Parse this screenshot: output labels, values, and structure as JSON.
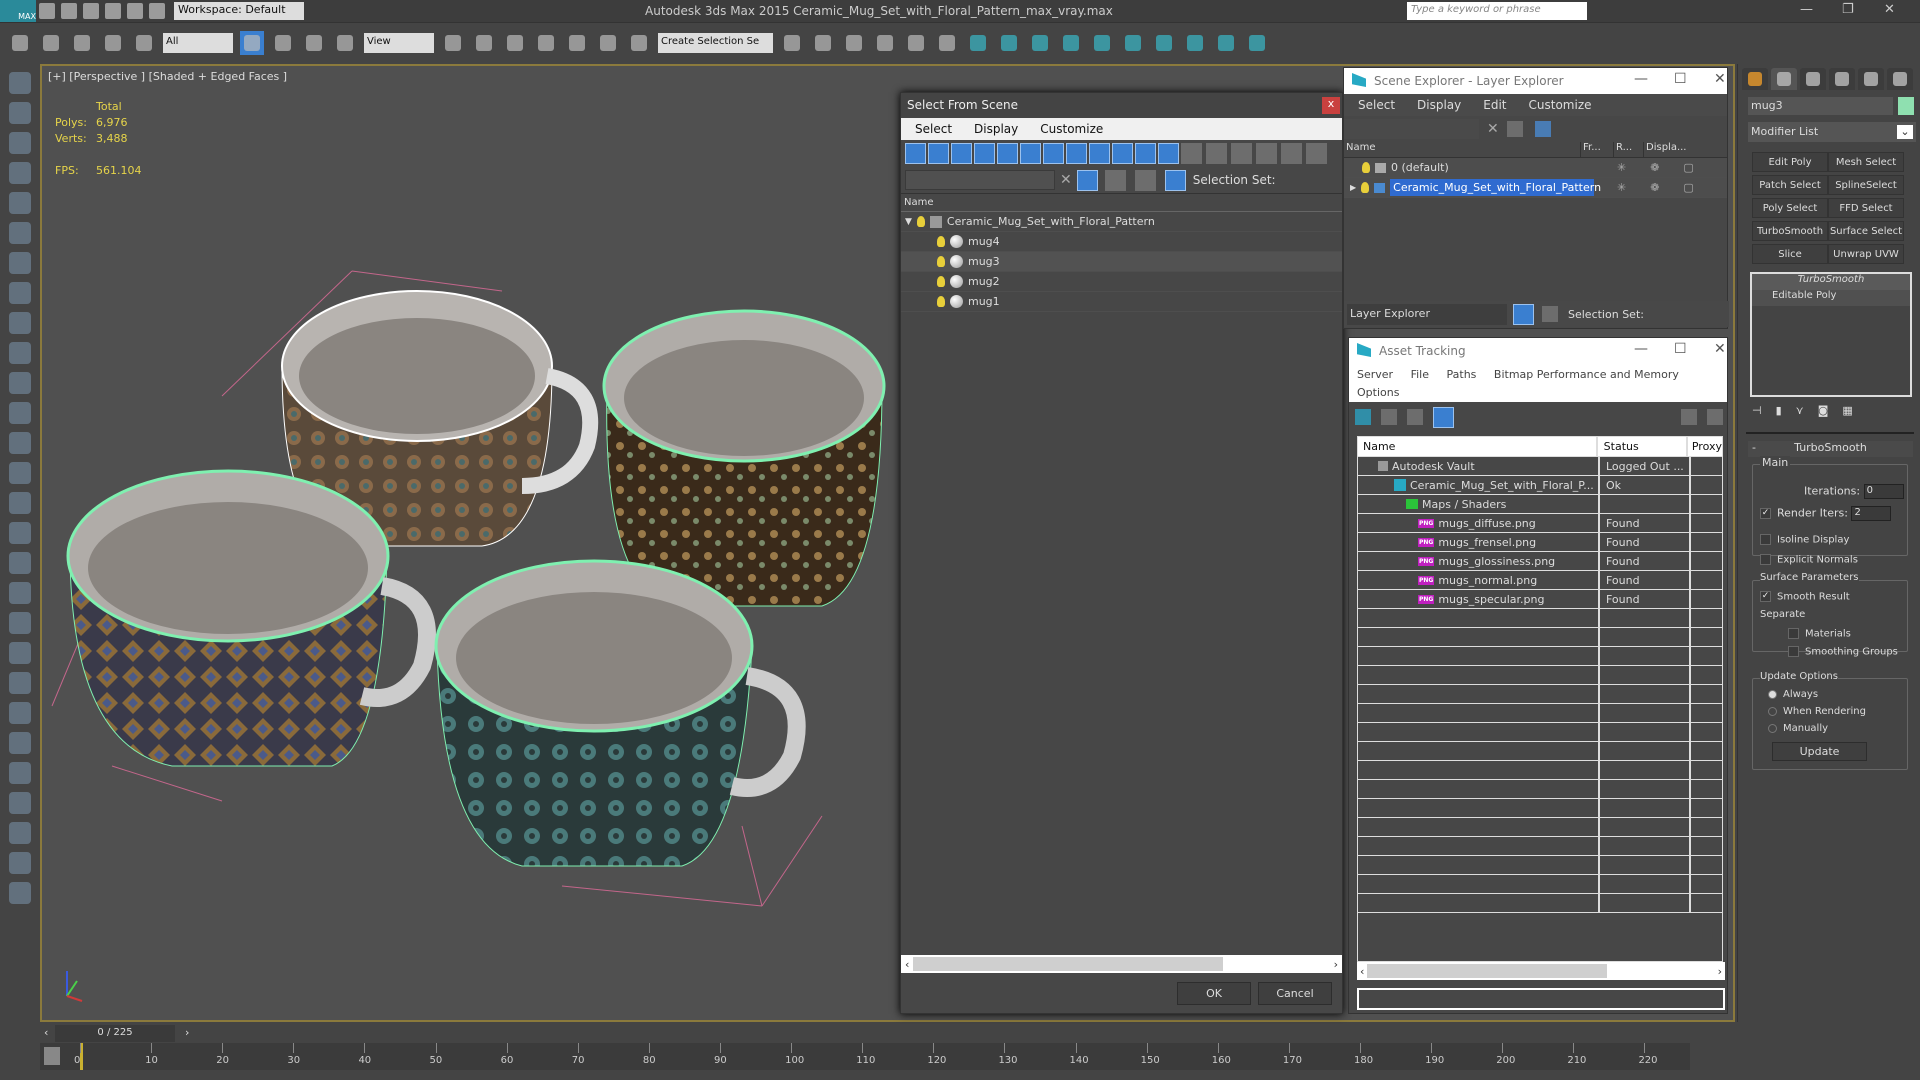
{
  "titlebar": {
    "workspace": "Workspace: Default",
    "title": "Autodesk 3ds Max  2015    Ceramic_Mug_Set_with_Floral_Pattern_max_vray.max",
    "search_placeholder": "Type a keyword or phrase",
    "minimize": "—",
    "restore": "❐",
    "close": "✕"
  },
  "toolbar": {
    "filter": "All",
    "view": "View",
    "selection_set": "Create Selection Se",
    "icons": [
      "undo-icon",
      "redo-icon",
      "link-icon",
      "unlink-icon",
      "bind-space-warp-icon",
      "select-object-icon",
      "select-by-name-icon",
      "rect-selection-icon",
      "window-crossing-icon",
      "move-icon",
      "rotate-icon",
      "scale-icon",
      "select-manipulate-icon",
      "mirror-icon",
      "align-icon",
      "layer-manager-icon",
      "curve-editor-icon",
      "schematic-view-icon",
      "material-editor-icon",
      "render-setup-icon",
      "render-frame-icon",
      "render-icon",
      "light-icon",
      "camera-icon",
      "helper-icon",
      "shapes-icon",
      "space-warp-icon",
      "systems-icon",
      "particle-icon",
      "terrain-icon",
      "hair-icon",
      "cloth-icon"
    ]
  },
  "viewport": {
    "label": "[+] [Perspective ] [Shaded + Edged Faces ]",
    "stats": {
      "header": "Total",
      "polys_label": "Polys:",
      "polys": "6,976",
      "verts_label": "Verts:",
      "verts": "3,488",
      "fps_label": "FPS:",
      "fps": "561.104"
    }
  },
  "select_from_scene": {
    "title": "Select From Scene",
    "close": "x",
    "menu": [
      "Select",
      "Display",
      "Customize"
    ],
    "selection_set_label": "Selection Set:",
    "column": "Name",
    "root": "Ceramic_Mug_Set_with_Floral_Pattern",
    "items": [
      "mug4",
      "mug3",
      "mug2",
      "mug1"
    ],
    "ok": "OK",
    "cancel": "Cancel"
  },
  "scene_explorer": {
    "title": "Scene Explorer - Layer Explorer",
    "menu": [
      "Select",
      "Display",
      "Edit",
      "Customize"
    ],
    "columns": [
      "Name",
      "Fr...",
      "R...",
      "Displa..."
    ],
    "layers": [
      "0 (default)",
      "Ceramic_Mug_Set_with_Floral_Pattern"
    ],
    "explorer_dropdown": "Layer Explorer",
    "selection_set_label": "Selection Set:"
  },
  "asset_tracking": {
    "title": "Asset Tracking",
    "menu": [
      "Server",
      "File",
      "Paths",
      "Bitmap Performance and Memory",
      "Options"
    ],
    "columns": [
      "Name",
      "Status",
      "Proxy"
    ],
    "rows": [
      {
        "name": "Autodesk Vault",
        "status": "Logged Out ..."
      },
      {
        "name": "Ceramic_Mug_Set_with_Floral_P...",
        "status": "Ok"
      },
      {
        "name": "Maps / Shaders",
        "status": ""
      },
      {
        "name": "mugs_diffuse.png",
        "status": "Found"
      },
      {
        "name": "mugs_frensel.png",
        "status": "Found"
      },
      {
        "name": "mugs_glossiness.png",
        "status": "Found"
      },
      {
        "name": "mugs_normal.png",
        "status": "Found"
      },
      {
        "name": "mugs_specular.png",
        "status": "Found"
      }
    ],
    "png_badge": "PNG"
  },
  "command_panel": {
    "object_name": "mug3",
    "object_color": "#8fe0b0",
    "modifier_list": "Modifier List",
    "modifier_buttons": [
      "Edit Poly",
      "Mesh Select",
      "Patch Select",
      "SplineSelect",
      "Poly Select",
      "FFD Select",
      "TurboSmooth",
      "Surface Select",
      "Slice",
      "Unwrap UVW"
    ],
    "stack": [
      "TurboSmooth",
      "Editable Poly"
    ],
    "turbosmooth": {
      "title": "TurboSmooth",
      "main": "Main",
      "iterations_label": "Iterations:",
      "iterations": "0",
      "render_iters_label": "Render Iters:",
      "render_iters": "2",
      "isoline": "Isoline Display",
      "explicit_normals": "Explicit Normals",
      "surface_params": "Surface Parameters",
      "smooth_result": "Smooth Result",
      "separate": "Separate",
      "materials": "Materials",
      "smoothing_groups": "Smoothing Groups",
      "update_options": "Update Options",
      "always": "Always",
      "when_rendering": "When Rendering",
      "manually": "Manually",
      "update": "Update"
    }
  },
  "timeline": {
    "frame": "0 / 225",
    "ticks": [
      "0",
      "10",
      "20",
      "30",
      "40",
      "50",
      "60",
      "70",
      "80",
      "90",
      "100",
      "110",
      "120",
      "130",
      "140",
      "150",
      "160",
      "170",
      "180",
      "190",
      "200",
      "210",
      "220"
    ],
    "max_frame": 225
  },
  "colors": {
    "accent": "#3a7fd0",
    "wire": "#7ff0b0",
    "viewport_border": "#8b7a3c",
    "stats": "#e6d44a"
  }
}
